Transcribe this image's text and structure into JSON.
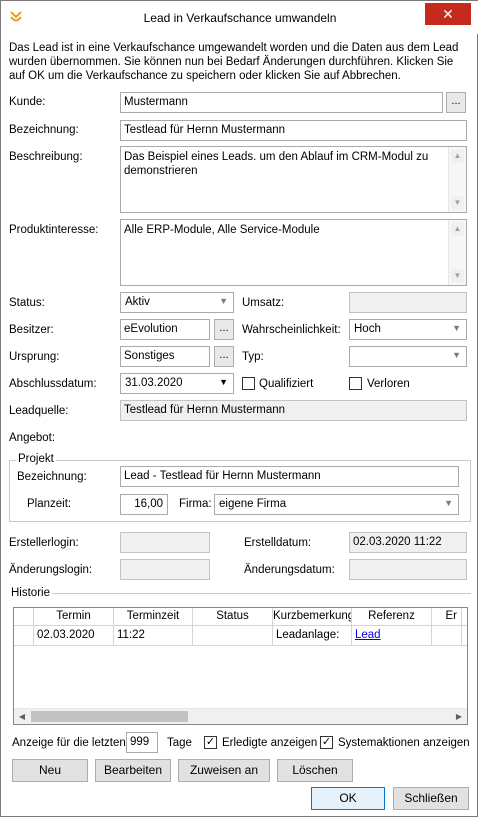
{
  "window": {
    "title": "Lead in Verkaufschance umwandeln",
    "close_glyph": "✕"
  },
  "intro_text": "Das Lead ist in eine Verkaufschance umgewandelt worden und die Daten aus dem Lead wurden übernommen. Sie können nun bei Bedarf Änderungen durchführen. Klicken Sie auf OK um die Verkaufschance zu speichern oder klicken Sie auf Abbrechen.",
  "form": {
    "kunde": {
      "label": "Kunde:",
      "value": "Mustermann",
      "button": "..."
    },
    "bezeichnung": {
      "label": "Bezeichnung:",
      "value": "Testlead für Hernn Mustermann"
    },
    "beschreibung": {
      "label": "Beschreibung:",
      "value": "Das Beispiel eines Leads. um den Ablauf im CRM-Modul zu demonstrieren"
    },
    "produktinteresse": {
      "label": "Produktinteresse:",
      "value": "Alle ERP-Module, Alle Service-Module"
    },
    "status": {
      "label": "Status:",
      "value": "Aktiv"
    },
    "umsatz": {
      "label": "Umsatz:",
      "value": ""
    },
    "besitzer": {
      "label": "Besitzer:",
      "value": "eEvolution",
      "button": "..."
    },
    "wahrscheinlichkeit": {
      "label": "Wahrscheinlichkeit:",
      "value": "Hoch"
    },
    "ursprung": {
      "label": "Ursprung:",
      "value": "Sonstiges",
      "button": "..."
    },
    "typ": {
      "label": "Typ:",
      "value": ""
    },
    "abschlussdatum": {
      "label": "Abschlussdatum:",
      "value": "31.03.2020"
    },
    "qualifiziert": {
      "label": "Qualifiziert",
      "checked": false
    },
    "verloren": {
      "label": "Verloren",
      "checked": false
    },
    "leadquelle": {
      "label": "Leadquelle:",
      "value": "Testlead für Hernn Mustermann"
    },
    "angebot": {
      "label": "Angebot:"
    }
  },
  "projekt": {
    "group_title": "Projekt",
    "bezeichnung": {
      "label": "Bezeichnung:",
      "value": "Lead - Testlead für Hernn Mustermann"
    },
    "planzeit": {
      "label": "Planzeit:",
      "value": "16,00"
    },
    "firma": {
      "label": "Firma:",
      "value": "eigene Firma"
    }
  },
  "meta": {
    "erstellerlogin": {
      "label": "Erstellerlogin:",
      "value": ""
    },
    "erstelldatum": {
      "label": "Erstelldatum:",
      "value": "02.03.2020 11:22"
    },
    "aenderungslogin": {
      "label": "Änderungslogin:",
      "value": ""
    },
    "aenderungsdatum": {
      "label": "Änderungsdatum:",
      "value": ""
    }
  },
  "historie": {
    "group_title": "Historie",
    "columns": [
      "Termin",
      "Terminzeit",
      "Status",
      "Kurzbemerkung",
      "Referenz",
      "Er"
    ],
    "rows": [
      {
        "termin": "02.03.2020",
        "terminzeit": "11:22",
        "status": "",
        "kurzbemerkung": "Leadanlage:",
        "referenz": "Lead",
        "er": ""
      }
    ]
  },
  "filter": {
    "prefix": "Anzeige für die letzten",
    "days": "999",
    "suffix": "Tage",
    "erledigte": {
      "label": "Erledigte anzeigen",
      "checked": true
    },
    "systemaktionen": {
      "label": "Systemaktionen anzeigen",
      "checked": true
    }
  },
  "actions": {
    "neu": "Neu",
    "bearbeiten": "Bearbeiten",
    "zuweisen": "Zuweisen an",
    "loeschen": "Löschen"
  },
  "footer": {
    "ok": "OK",
    "schliessen": "Schließen"
  },
  "glyphs": {
    "check": "✓",
    "dropdown": "▼",
    "up": "▲",
    "down": "▼",
    "left": "◀",
    "right": "▶"
  },
  "colors": {
    "close": "#c42b1c",
    "link": "#0000ee",
    "default_button_border": "#0078d7"
  }
}
